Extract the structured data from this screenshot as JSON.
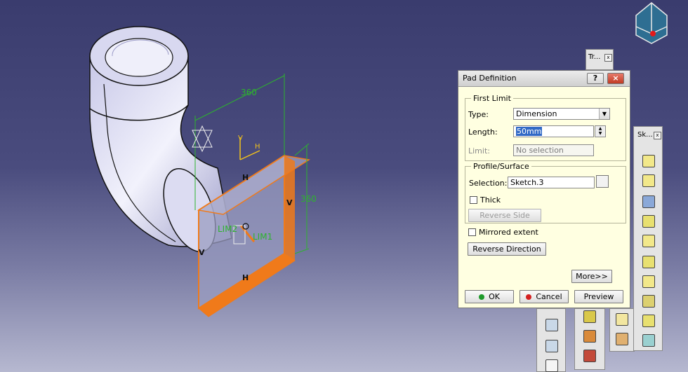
{
  "dialog": {
    "title": "Pad Definition",
    "help_label": "?",
    "close_label": "×",
    "first_limit": {
      "legend": "First Limit",
      "type_label": "Type:",
      "type_value": "Dimension",
      "length_label": "Length:",
      "length_value": "50mm",
      "limit_label": "Limit:",
      "limit_value": "No selection"
    },
    "profile": {
      "legend": "Profile/Surface",
      "selection_label": "Selection:",
      "selection_value": "Sketch.3",
      "thick_label": "Thick",
      "reverse_side_label": "Reverse Side"
    },
    "mirrored_label": "Mirrored extent",
    "reverse_direction_label": "Reverse Direction",
    "more_label": "More>>",
    "ok_label": "OK",
    "cancel_label": "Cancel",
    "preview_label": "Preview"
  },
  "viewport": {
    "dim_top": "360",
    "dim_right": "360",
    "lim1": "LIM1",
    "lim2": "LIM2",
    "h_label": "H",
    "v_label": "V",
    "axis_v": "V",
    "axis_h": "H"
  },
  "toolbars": {
    "tr_title": "Tr...",
    "sk_title": "Sk...",
    "close_x": "x"
  },
  "colors": {
    "accent_orange": "#f07a1a",
    "dimension_green": "#2db42d",
    "pipe_lavender": "#c9c9e8",
    "dialog_bg": "#ffffe1"
  }
}
